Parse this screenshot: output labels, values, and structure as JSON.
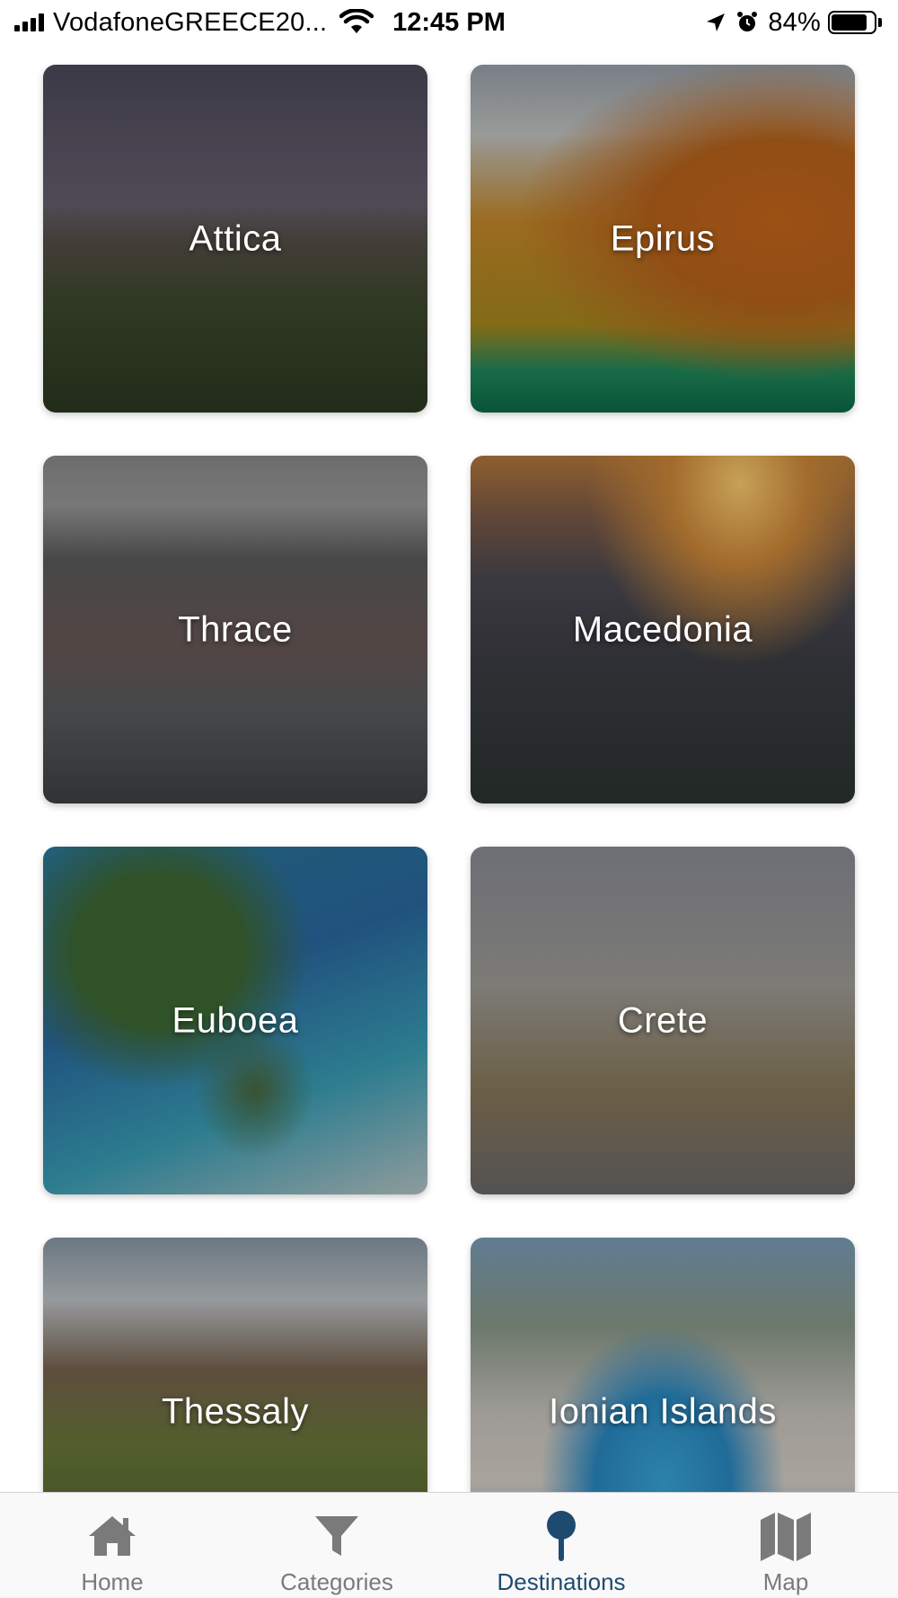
{
  "status_bar": {
    "carrier": "VodafoneGREECE20...",
    "time": "12:45 PM",
    "battery": "84%",
    "battery_level": 0.84,
    "icons": [
      "signal-icon",
      "wifi-icon",
      "location-arrow-icon",
      "alarm-icon",
      "battery-icon"
    ]
  },
  "destinations": [
    {
      "name": "Attica"
    },
    {
      "name": "Epirus"
    },
    {
      "name": "Thrace"
    },
    {
      "name": "Macedonia"
    },
    {
      "name": "Euboea"
    },
    {
      "name": "Crete"
    },
    {
      "name": "Thessaly"
    },
    {
      "name": "Ionian Islands"
    }
  ],
  "tab_bar": {
    "tabs": [
      {
        "label": "Home",
        "icon": "home-icon"
      },
      {
        "label": "Categories",
        "icon": "filter-icon"
      },
      {
        "label": "Destinations",
        "icon": "pin-icon"
      },
      {
        "label": "Map",
        "icon": "map-icon"
      }
    ],
    "active": "Destinations",
    "active_color": "#1f4a70",
    "inactive_color": "#7a7a7a"
  }
}
